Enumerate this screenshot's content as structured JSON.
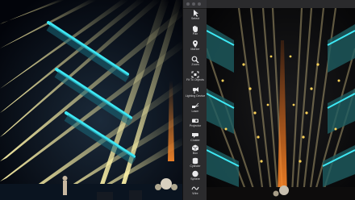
{
  "window": {
    "traffic_lights": [
      "close-button",
      "minimize-button",
      "zoom-button"
    ]
  },
  "tools": [
    {
      "label": "Select",
      "icon": "cursor-icon"
    },
    {
      "label": "Pan",
      "icon": "hand-icon"
    },
    {
      "label": "Marker",
      "icon": "marker-icon"
    },
    {
      "label": "Zoom",
      "icon": "magnifier-icon"
    },
    {
      "label": "Fit To Objects",
      "icon": "fit-objects-icon"
    },
    {
      "label": "Lighting Device",
      "icon": "lighting-device-icon"
    },
    {
      "label": "Laser",
      "icon": "laser-icon"
    },
    {
      "label": "Projector",
      "icon": "projector-icon"
    },
    {
      "label": "Cluster",
      "icon": "cluster-icon"
    },
    {
      "label": "Box",
      "icon": "box-icon"
    },
    {
      "label": "Cylinder",
      "icon": "cylinder-icon"
    },
    {
      "label": "Sphere",
      "icon": "sphere-icon"
    },
    {
      "label": "Wire",
      "icon": "wire-icon"
    }
  ],
  "colors": {
    "beam_yellow": "#f2e27a",
    "beam_cyan": "#29d6e8",
    "beam_orange": "#ff7a1a",
    "palette_bg": "#2b2b2d"
  }
}
